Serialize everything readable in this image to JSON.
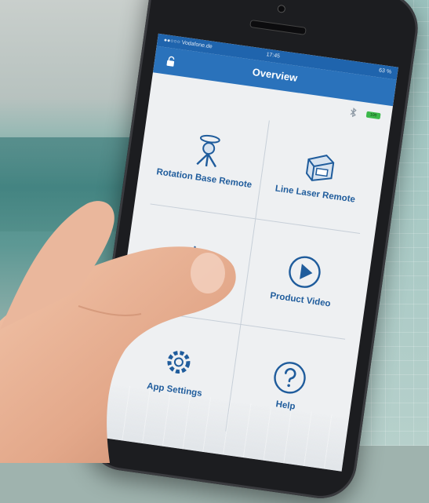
{
  "status_bar": {
    "carrier": "●●○○○ Vodafone.de",
    "time": "17:45",
    "battery": "63 %"
  },
  "nav": {
    "title": "Overview"
  },
  "battery_badge": "100",
  "tiles": [
    {
      "label": "Rotation Base Remote",
      "icon": "rotation-base-icon"
    },
    {
      "label": "Line Laser Remote",
      "icon": "line-laser-icon"
    },
    {
      "label": "",
      "icon": "brightness-icon"
    },
    {
      "label": "Product Video",
      "icon": "play-icon"
    },
    {
      "label": "App Settings",
      "icon": "gear-icon"
    },
    {
      "label": "Help",
      "icon": "help-icon"
    }
  ],
  "colors": {
    "navbar": "#2a72bb",
    "accent": "#1f5c9c",
    "battery": "#3cb84a"
  }
}
